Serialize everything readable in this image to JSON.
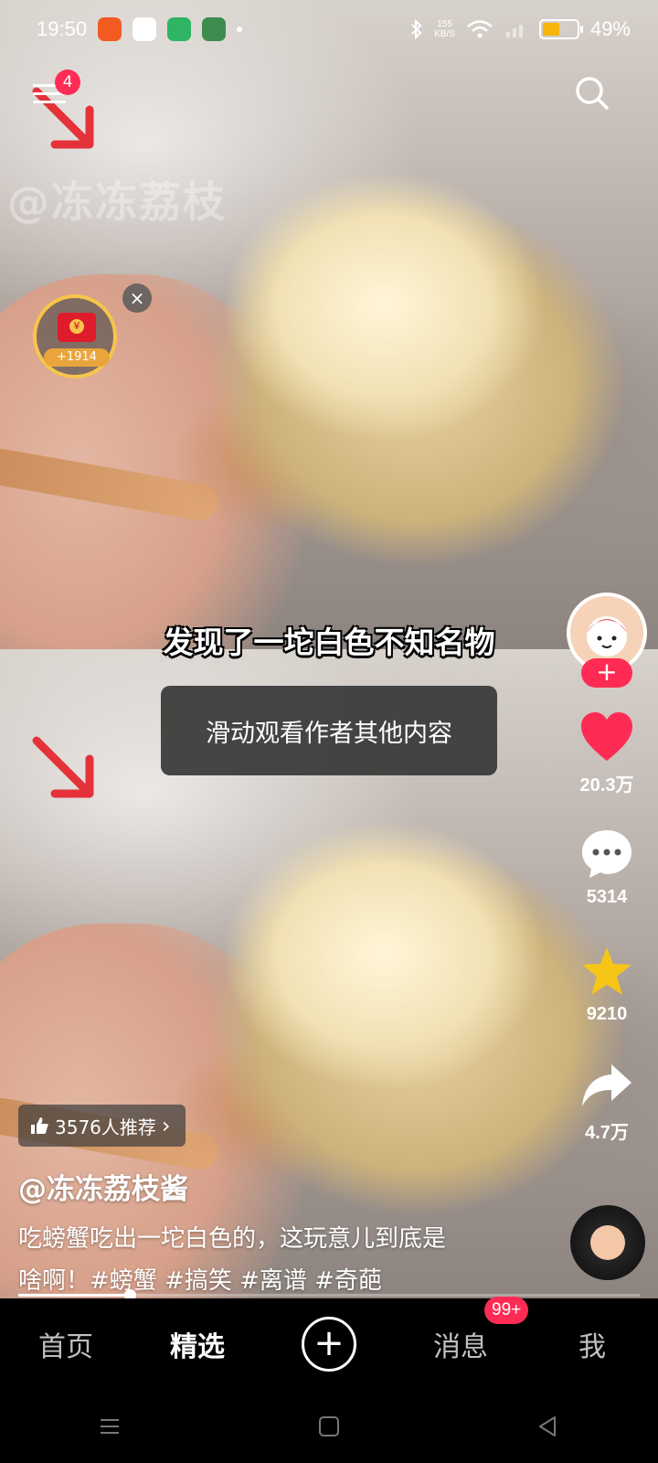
{
  "status_bar": {
    "time": "19:50",
    "net_speed_value": "155",
    "net_speed_unit": "KB/S",
    "battery": "49%",
    "battery_level": 0.49
  },
  "top": {
    "menu_badge": "4"
  },
  "video": {
    "watermark": "@冻冻荔枝",
    "subtitle": "发现了一坨白色不知名物"
  },
  "red_envelope": {
    "amount": "+1914",
    "close_glyph": "×"
  },
  "toast": {
    "text": "滑动观看作者其他内容"
  },
  "actions": {
    "follow_glyph": "+",
    "likes": "20.3万",
    "comments": "5314",
    "favorites": "9210",
    "shares": "4.7万"
  },
  "info": {
    "recommend": "3576人推荐",
    "recommend_chevron": "›",
    "author": "@冻冻荔枝酱",
    "description_line1": "吃螃蟹吃出一坨白色的，这玩意儿到底是",
    "description_line2": "啥啊！#螃蟹 #搞笑 #离谱 #奇葩",
    "progress": 0.18
  },
  "bottom_nav": {
    "home": "首页",
    "featured": "精选",
    "plus": "+",
    "messages": "消息",
    "messages_badge": "99+",
    "me": "我"
  },
  "colors": {
    "accent": "#fe2c55",
    "gold": "#f7c54a",
    "like_red": "#fe2c55",
    "star": "#f5c518"
  },
  "icons": [
    "menu-icon",
    "search-icon",
    "heart-icon",
    "comment-icon",
    "star-icon",
    "share-icon",
    "thumb-up-icon",
    "music-disc-icon"
  ]
}
